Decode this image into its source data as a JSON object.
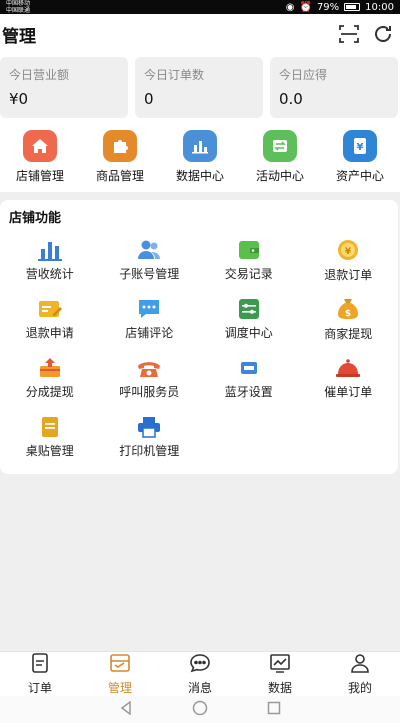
{
  "status_bar": {
    "carrier_top": "中国移动",
    "carrier_bottom": "中国联通",
    "signal_text": "46 4G",
    "battery": "79%",
    "time": "10:00"
  },
  "header": {
    "title": "管理",
    "scan_icon": "scan-icon",
    "refresh_icon": "refresh-icon"
  },
  "stats": [
    {
      "label": "今日营业额",
      "value": "¥0"
    },
    {
      "label": "今日订单数",
      "value": "0"
    },
    {
      "label": "今日应得",
      "value": "0.0"
    }
  ],
  "quick_nav": [
    {
      "label": "店铺管理",
      "icon": "home-icon",
      "color": "#ef6a4c"
    },
    {
      "label": "商品管理",
      "icon": "puzzle-icon",
      "color": "#e58a2a"
    },
    {
      "label": "数据中心",
      "icon": "bar-chart-icon",
      "color": "#4a90d9"
    },
    {
      "label": "活动中心",
      "icon": "exchange-icon",
      "color": "#5cbf5a"
    },
    {
      "label": "资产中心",
      "icon": "yen-icon",
      "color": "#2f86d6"
    }
  ],
  "functions": {
    "title": "店铺功能",
    "items": [
      {
        "label": "营收统计",
        "icon": "bar-chart-icon"
      },
      {
        "label": "子账号管理",
        "icon": "users-icon"
      },
      {
        "label": "交易记录",
        "icon": "wallet-icon"
      },
      {
        "label": "退款订单",
        "icon": "coin-icon"
      },
      {
        "label": "退款申请",
        "icon": "edit-card-icon"
      },
      {
        "label": "店铺评论",
        "icon": "comment-icon"
      },
      {
        "label": "调度中心",
        "icon": "sliders-icon"
      },
      {
        "label": "商家提现",
        "icon": "money-bag-icon"
      },
      {
        "label": "分成提现",
        "icon": "withdraw-box-icon"
      },
      {
        "label": "呼叫服务员",
        "icon": "phone-icon"
      },
      {
        "label": "蓝牙设置",
        "icon": "bluetooth-device-icon"
      },
      {
        "label": "催单订单",
        "icon": "bell-cloche-icon"
      },
      {
        "label": "桌贴管理",
        "icon": "document-icon"
      },
      {
        "label": "打印机管理",
        "icon": "printer-icon"
      }
    ]
  },
  "tabbar": [
    {
      "label": "订单",
      "icon": "order-icon",
      "active": false
    },
    {
      "label": "管理",
      "icon": "manage-icon",
      "active": true
    },
    {
      "label": "消息",
      "icon": "message-icon",
      "active": false
    },
    {
      "label": "数据",
      "icon": "data-icon",
      "active": false
    },
    {
      "label": "我的",
      "icon": "profile-icon",
      "active": false
    }
  ],
  "colors": {
    "accent": "#d28a2c",
    "background": "#efefef",
    "card": "#ffffff"
  }
}
